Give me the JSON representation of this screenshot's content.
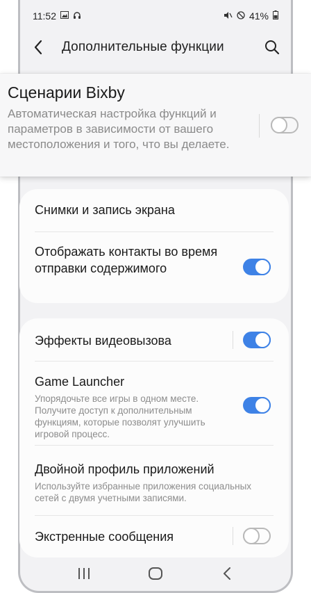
{
  "status_bar": {
    "time": "11:52",
    "battery": "41%"
  },
  "app_bar": {
    "title": "Дополнительные функции"
  },
  "bixby": {
    "title": "Сценарии Bixby",
    "description": "Автоматическая настройка функций и параметров в зависимости от вашего местоположения и того, что вы делаете.",
    "enabled": false
  },
  "group1": {
    "items": [
      {
        "title": "Снимки и запись экрана"
      },
      {
        "title": "Отображать контакты во время отправки содержимого",
        "enabled": true
      }
    ]
  },
  "group2": {
    "items": [
      {
        "title": "Эффекты видеовызова",
        "enabled": true
      },
      {
        "title": "Game Launcher",
        "subtitle": "Упорядочьте все игры в одном месте. Получите доступ к дополнительным функциям, которые позволят улучшить игровой процесс.",
        "enabled": true
      },
      {
        "title": "Двойной профиль приложений",
        "subtitle": "Используйте избранные приложения социальных сетей с двумя учетными записями."
      },
      {
        "title": "Экстренные сообщения",
        "enabled": false
      }
    ]
  },
  "colors": {
    "accent": "#3e82e6",
    "background": "#f2f2f4",
    "card": "#fcfcfc"
  },
  "icons": [
    "image-icon",
    "headset-icon",
    "mute-icon",
    "dnd-icon",
    "battery-icon",
    "back-icon",
    "search-icon",
    "recents-icon",
    "home-icon",
    "nav-back-icon"
  ]
}
